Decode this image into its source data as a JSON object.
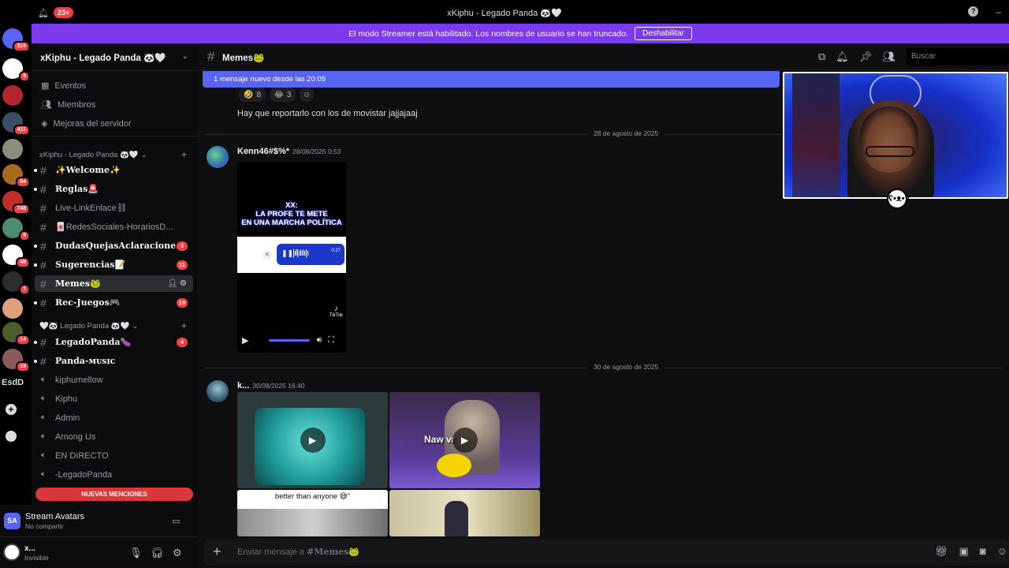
{
  "titlebar": {
    "title": "xKiphu - Legado Panda 🐼🤍",
    "notif_count": "23+"
  },
  "streamer_mode": {
    "message": "El modo Streamer está habilitado. Los nombres de usuario se han truncado.",
    "button_label": "Deshabilitar"
  },
  "servers": [
    {
      "badge": "315",
      "color": "#5865f2"
    },
    {
      "badge": "8",
      "color": "#ffffff"
    },
    {
      "badge": "",
      "color": "#b0262b"
    },
    {
      "badge": "411",
      "color": "#3c4e66"
    },
    {
      "badge": "",
      "color": "#8a8f7c"
    },
    {
      "badge": "64",
      "color": "#a86b1e"
    },
    {
      "badge": "748",
      "color": "#c22e2e"
    },
    {
      "badge": "9",
      "color": "#4f8b6e"
    },
    {
      "badge": "49",
      "color": "#ffffff"
    },
    {
      "badge": "1",
      "color": "#2b2d31"
    },
    {
      "badge": "",
      "color": "#e0a07a"
    },
    {
      "badge": "14",
      "color": "#4c5c2a"
    },
    {
      "badge": "19",
      "color": "#8d5a5a"
    }
  ],
  "server_text_item": "EsdD",
  "sidebar": {
    "server_name": "xKiphu - Legado Panda 🐼🤍",
    "nav": [
      {
        "icon": "calendar-icon",
        "label": "Eventos"
      },
      {
        "icon": "members-icon",
        "label": "Miembros"
      },
      {
        "icon": "boost-icon",
        "label": "Mejoras del servidor"
      }
    ],
    "category1": "xKiphu - Legado Panda 🐼🤍",
    "channels1": [
      {
        "name": "✨Welcome✨",
        "unread": true,
        "mentions": ""
      },
      {
        "name": "Reglas🚨",
        "unread": true,
        "mentions": ""
      },
      {
        "name": "Live-LinkEnlace⛓",
        "unread": false,
        "mentions": ""
      },
      {
        "name": "🀄RedesSociales-HorariosD...",
        "unread": false,
        "mentions": ""
      },
      {
        "name": "DudasQuejasAclaracione...",
        "unread": true,
        "mentions": "3"
      },
      {
        "name": "Sugerencias📝",
        "unread": true,
        "mentions": "11"
      },
      {
        "name": "Memes🐸",
        "unread": false,
        "mentions": "",
        "active": true
      },
      {
        "name": "Rec-Juegos🎮",
        "unread": true,
        "mentions": "19"
      }
    ],
    "category2": "🤍🐼 Legado Panda 🐼🤍",
    "channels2": [
      {
        "name": "LegadoPanda🍆",
        "type": "text",
        "unread": true,
        "mentions": "4"
      },
      {
        "name": "Panda-ᴍᴜsɪᴄ",
        "type": "text",
        "unread": true,
        "mentions": ""
      },
      {
        "name": "kiphumellow",
        "type": "voice",
        "unread": false,
        "mentions": ""
      },
      {
        "name": "Kiphu",
        "type": "voice",
        "unread": false,
        "mentions": ""
      },
      {
        "name": "Admin",
        "type": "voice",
        "unread": false,
        "mentions": ""
      },
      {
        "name": "Among Us",
        "type": "voice",
        "unread": false,
        "mentions": ""
      },
      {
        "name": "EN DIRECTO",
        "type": "voice",
        "unread": false,
        "mentions": ""
      },
      {
        "name": "-LegadoPanda",
        "type": "voice",
        "unread": false,
        "mentions": ""
      }
    ],
    "new_mentions": "NUEVAS MENCIONES"
  },
  "stream_avatars": {
    "icon_text": "SA",
    "title": "Stream Avatars",
    "subtitle": "No compartir"
  },
  "user": {
    "name": "x...",
    "status": "Invisible"
  },
  "channel_header": {
    "name": "Memes🐸",
    "search_placeholder": "Buscar"
  },
  "new_messages_bar": "1 mensaje nuevo desde las 20:09",
  "reactions": [
    {
      "emoji": "🤣",
      "count": "8"
    },
    {
      "emoji": "😂",
      "count": "3"
    }
  ],
  "messages": {
    "first_text": "Hay que reportarlo con los de movistar jajjajaaj",
    "date1": "28 de agosto de 2025",
    "msg2": {
      "author": "Kenn46#$%*",
      "timestamp": "28/08/2025 0:53",
      "video_caption_line1": "XX:",
      "video_caption_line2": "LA PROFE TE METE",
      "video_caption_line3": "EN UNA MARCHA POLÍTICA",
      "audio_time": "0:27",
      "tiktok_label": "TikTok"
    },
    "date2": "30 de agosto de 2025",
    "msg3": {
      "author": "k...",
      "timestamp": "30/08/2025 16:40",
      "caption_tile": "better than anyone 😅\"",
      "overlay_text": "Naw vr"
    }
  },
  "composer_placeholder_prefix": "Enviar mensaje a ",
  "composer_placeholder_channel": "#Memes🐸"
}
